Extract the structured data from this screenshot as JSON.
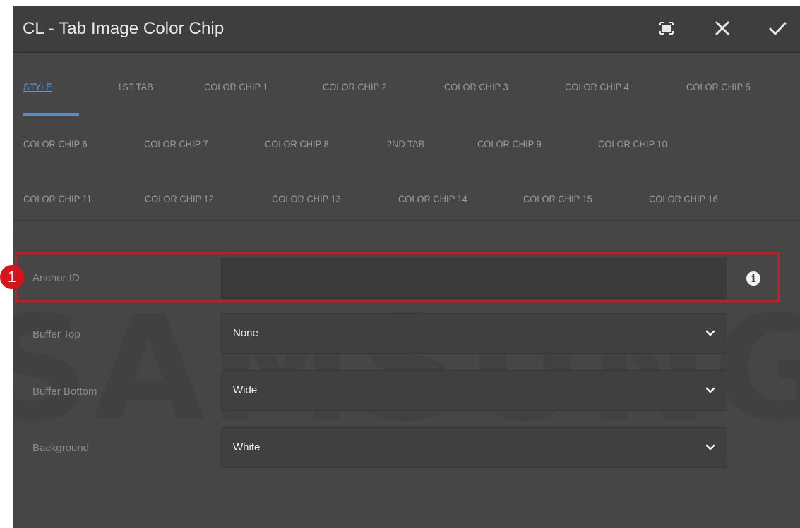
{
  "dialog": {
    "title": "CL - Tab Image Color Chip",
    "actions": {
      "fullscreen_icon": "fullscreen-icon",
      "close_icon": "close-icon",
      "confirm_icon": "check-icon"
    }
  },
  "tabs": [
    "STYLE",
    "1ST TAB",
    "COLOR CHIP 1",
    "COLOR CHIP 2",
    "COLOR CHIP 3",
    "COLOR CHIP 4",
    "COLOR CHIP 5",
    "COLOR CHIP 6",
    "COLOR CHIP 7",
    "COLOR CHIP 8",
    "2ND TAB",
    "COLOR CHIP 9",
    "COLOR CHIP 10",
    "COLOR CHIP 11",
    "COLOR CHIP 12",
    "COLOR CHIP 13",
    "COLOR CHIP 14",
    "COLOR CHIP 15",
    "COLOR CHIP 16"
  ],
  "active_tab": "STYLE",
  "form": {
    "anchor_id": {
      "label": "Anchor ID",
      "value": "",
      "placeholder": ""
    },
    "buffer_top": {
      "label": "Buffer Top",
      "value": "None"
    },
    "buffer_bottom": {
      "label": "Buffer Bottom",
      "value": "Wide"
    },
    "background": {
      "label": "Background",
      "value": "White"
    }
  },
  "annotation": {
    "badge": "1"
  },
  "watermark": "SAMSUNG",
  "colors": {
    "dialog_bg": "#464646",
    "titlebar_bg": "#3e3e3e",
    "active_tab": "#5d99d8",
    "highlight": "#d7141a"
  }
}
